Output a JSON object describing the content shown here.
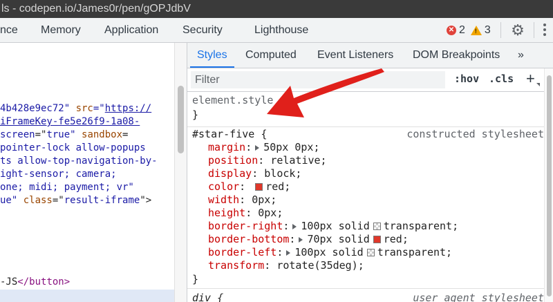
{
  "window": {
    "title": "ls - codepen.io/James0r/pen/gOPJdbV"
  },
  "devtools_tabs": [
    "nce",
    "Memory",
    "Application",
    "Security",
    "Lighthouse"
  ],
  "status": {
    "errors": "2",
    "warnings": "3"
  },
  "elements_panel": {
    "lines": [
      {
        "segments": [
          {
            "cls": "val",
            "t": "4b428e9ec72\" "
          },
          {
            "cls": "attr",
            "t": "src"
          },
          {
            "cls": "val",
            "t": "=\""
          },
          {
            "cls": "link",
            "t": "https://"
          }
        ]
      },
      {
        "segments": [
          {
            "cls": "link",
            "t": "iFrameKey-fe5e26f9-1a08-"
          }
        ]
      },
      {
        "segments": [
          {
            "cls": "val",
            "t": "screen"
          },
          {
            "cls": "txt",
            "t": "=\""
          },
          {
            "cls": "val",
            "t": "true\" "
          },
          {
            "cls": "attr",
            "t": "sandbox"
          },
          {
            "cls": "txt",
            "t": "="
          }
        ]
      },
      {
        "segments": [
          {
            "cls": "val",
            "t": "pointer-lock allow-popups"
          }
        ]
      },
      {
        "segments": [
          {
            "cls": "val",
            "t": "ts allow-top-navigation-by-"
          }
        ]
      },
      {
        "segments": [
          {
            "cls": "val",
            "t": "ight-sensor; camera;"
          }
        ]
      },
      {
        "segments": [
          {
            "cls": "val",
            "t": "one; midi; payment; vr\""
          }
        ]
      },
      {
        "segments": [
          {
            "cls": "val",
            "t": "ue\" "
          },
          {
            "cls": "attr",
            "t": "class"
          },
          {
            "cls": "txt",
            "t": "=\""
          },
          {
            "cls": "val",
            "t": "result-iframe"
          },
          {
            "cls": "txt",
            "t": "\">"
          }
        ]
      },
      {
        "segments": [
          {
            "cls": "txt",
            "t": "-JS"
          },
          {
            "cls": "tagc",
            "t": "</button>"
          }
        ]
      }
    ]
  },
  "subtabs": [
    "Styles",
    "Computed",
    "Event Listeners",
    "DOM Breakpoints",
    "»"
  ],
  "filter": {
    "placeholder": "Filter",
    "hov": ":hov",
    "cls": ".cls",
    "add": "+"
  },
  "rules": {
    "element_style": {
      "selector": "element.style {",
      "close": "}"
    },
    "star_five": {
      "selector": "#star-five {",
      "origin": "constructed stylesheet",
      "close": "}",
      "props": [
        {
          "name": "margin",
          "value": "50px 0px;",
          "expand": true
        },
        {
          "name": "position",
          "value": "relative;"
        },
        {
          "name": "display",
          "value": "block;"
        },
        {
          "name": "color",
          "value": "red;",
          "swatch": "#e0382b"
        },
        {
          "name": "width",
          "value": "0px;"
        },
        {
          "name": "height",
          "value": "0px;"
        },
        {
          "name": "border-right",
          "value": "100px solid",
          "expand": true,
          "swatch": "transparent",
          "tail": "transparent;"
        },
        {
          "name": "border-bottom",
          "value": "70px solid",
          "expand": true,
          "swatch": "#e0382b",
          "tail": "red;"
        },
        {
          "name": "border-left",
          "value": "100px solid",
          "expand": true,
          "swatch": "transparent",
          "tail": "transparent;"
        },
        {
          "name": "transform",
          "value": "rotate(35deg);"
        }
      ]
    },
    "div_rule": {
      "selector": "div {",
      "origin": "user agent stylesheet"
    }
  },
  "colors": {
    "accent": "#1a73e8",
    "property": "#c80000",
    "arrow": "#e0201b"
  }
}
